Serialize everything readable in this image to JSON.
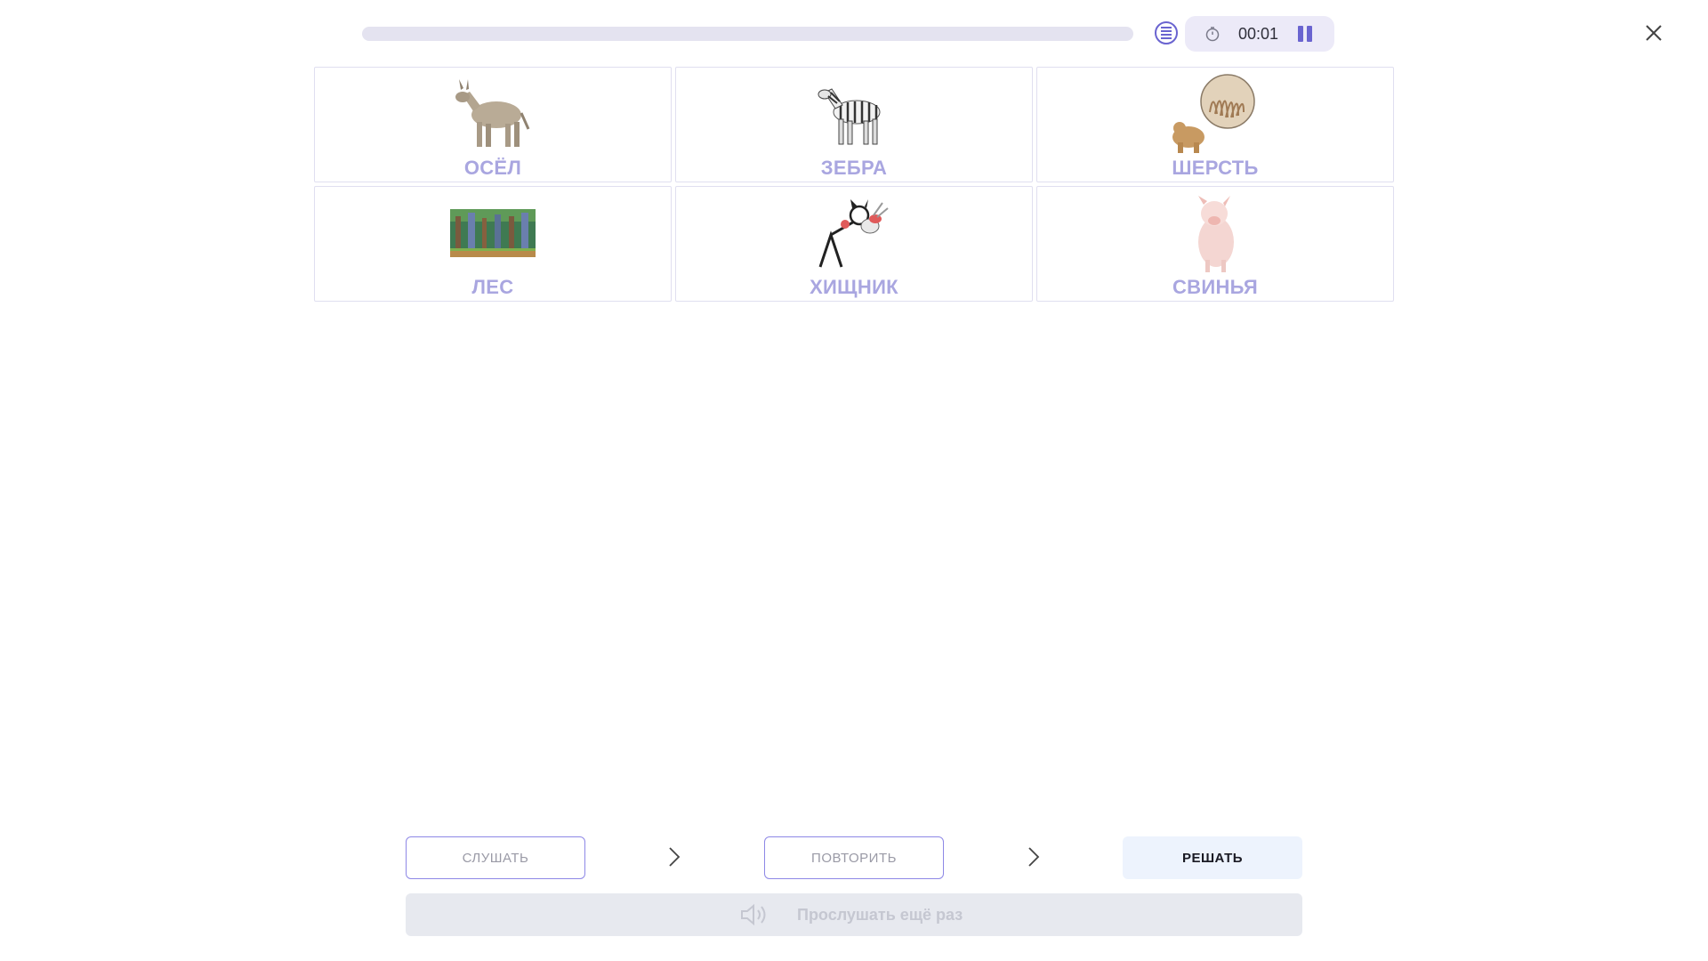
{
  "header": {
    "progress": 0,
    "timer": "00:01",
    "icons": [
      "list-icon",
      "stopwatch-icon",
      "pause-icon",
      "close-icon"
    ]
  },
  "cards": [
    {
      "word": "ОСЁЛ",
      "image": "donkey"
    },
    {
      "word": "ЗЕБРА",
      "image": "zebra"
    },
    {
      "word": "ШЕРСТЬ",
      "image": "fur-and-bear"
    },
    {
      "word": "ЛЕС",
      "image": "forest"
    },
    {
      "word": "ХИЩНИК",
      "image": "predator-wolf-catching-rabbit"
    },
    {
      "word": "СВИНЬЯ",
      "image": "pig"
    }
  ],
  "steps": {
    "listen": "СЛУШАТЬ",
    "repeat": "ПОВТОРИТЬ",
    "solve": "РЕШАТЬ"
  },
  "listen_again": {
    "label": "Прослушать ещё раз",
    "icon": "speaker-icon"
  },
  "colors": {
    "accent": "#6a64d0",
    "word": "#a9a6e0",
    "solve_bg": "#edf3fd",
    "track": "#e4e3f0"
  }
}
